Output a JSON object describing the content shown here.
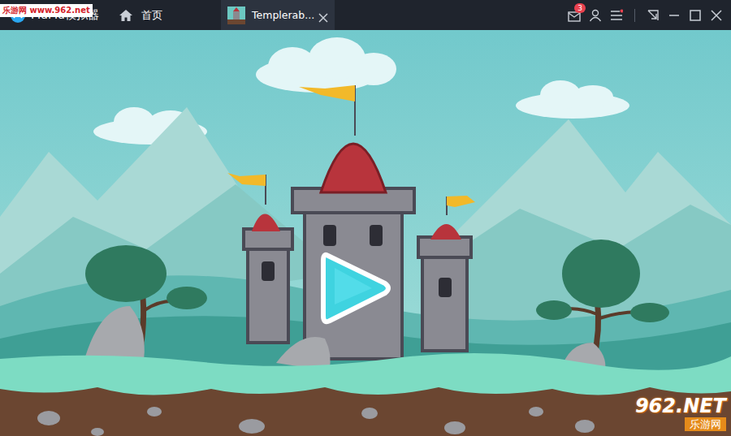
{
  "watermark_top": {
    "text": "乐游网 www.962.net"
  },
  "app": {
    "title": "MuMu模拟器"
  },
  "nav": {
    "home": "首页"
  },
  "tabs": [
    {
      "label": "Templerab...",
      "selected": true
    }
  ],
  "toolbar": {
    "mail_badge": "3"
  },
  "watermark_bottom": {
    "brand": "962.NET",
    "name": "乐游网"
  }
}
